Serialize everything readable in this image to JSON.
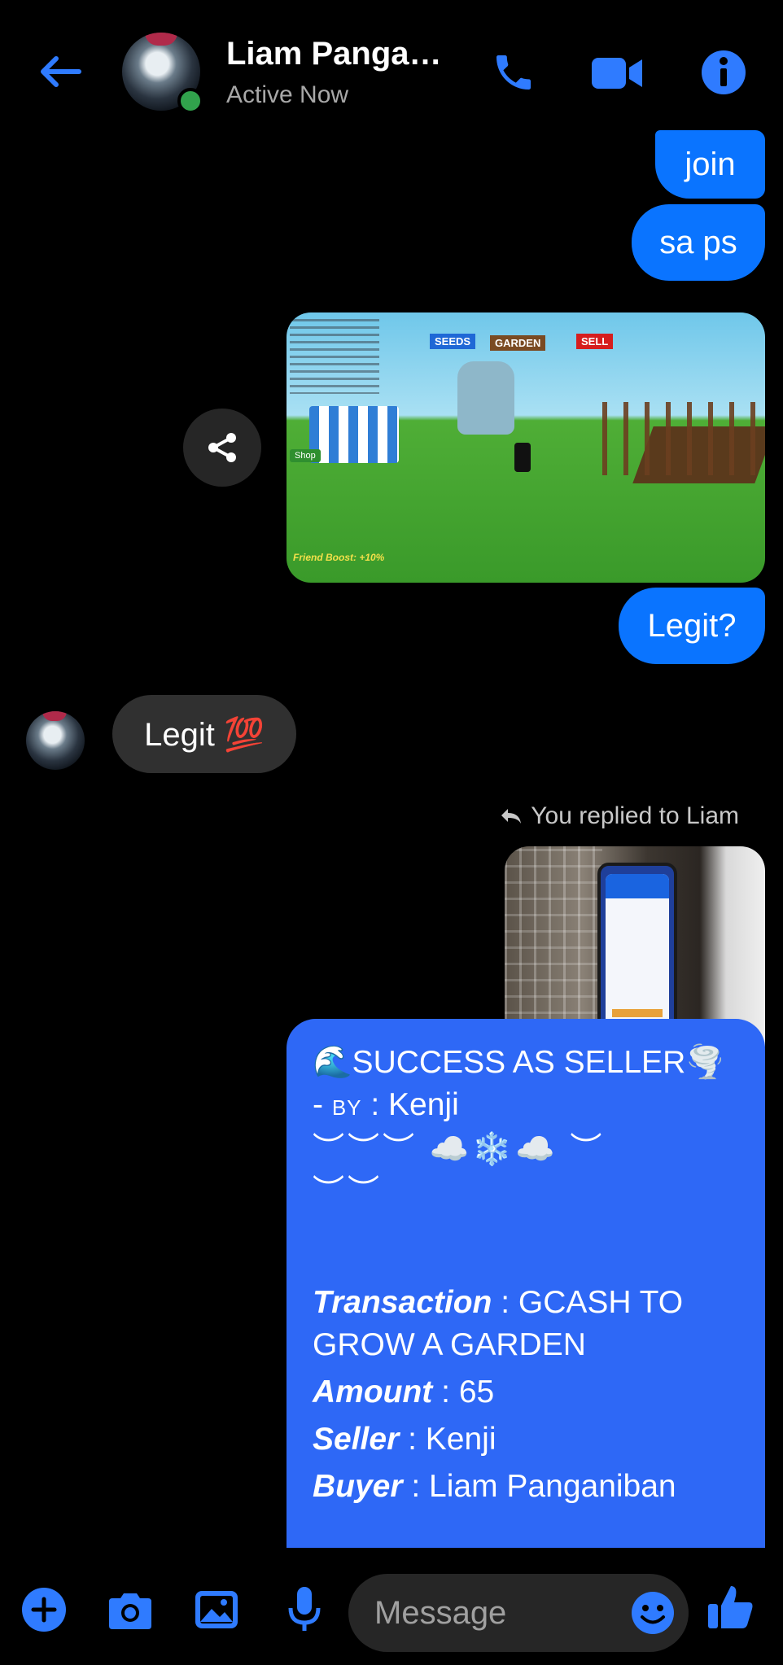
{
  "header": {
    "contact_name": "Liam Panga…",
    "status": "Active Now",
    "icons": [
      "back-arrow-icon",
      "phone-icon",
      "video-camera-icon",
      "info-icon"
    ]
  },
  "messages": {
    "m1": "join",
    "m2": "sa ps",
    "game_image": {
      "chip_seeds": "SEEDS",
      "chip_garden": "GARDEN",
      "chip_sell": "SELL",
      "shop_label": "Shop",
      "boost_text": "Friend Boost: +10%"
    },
    "m3": "Legit?",
    "incoming": "Legit 💯",
    "reply_note": "You replied to Liam",
    "seller_message": {
      "title": "🌊SUCCESS AS SELLER🌪️",
      "by_prefix": "- ",
      "by_label": "BY",
      "by_value": " : Kenji",
      "deco1": "︶︶︶ ☁️❄️☁️ ︶",
      "deco2": "︶︶",
      "transaction_label": "Transaction",
      "transaction_value": " : GCASH TO",
      "transaction_value2": "GROW A GARDEN",
      "amount_label": "Amount",
      "amount_value": " : 65",
      "seller_label": "Seller",
      "seller_value": " : Kenji",
      "buyer_label": "Buyer",
      "buyer_value": " : Liam Panganiban"
    }
  },
  "composer": {
    "placeholder": "Message",
    "icons": [
      "plus-icon",
      "camera-icon",
      "gallery-icon",
      "microphone-icon",
      "emoji-icon",
      "thumbs-up-icon"
    ]
  },
  "colors": {
    "accent": "#0a74ff",
    "outgoing_bubble": "#0a74ff",
    "incoming_bubble": "#303030",
    "presence": "#31a24c"
  }
}
